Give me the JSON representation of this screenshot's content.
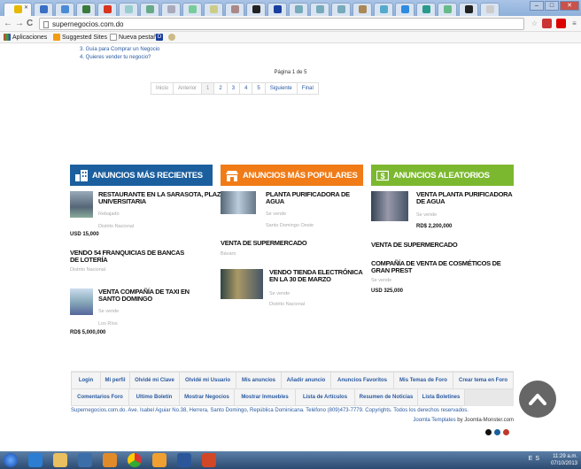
{
  "browser": {
    "url": "supernegocios.com.do",
    "bookmarks": [
      "Aplicaciones",
      "Suggested Sites",
      "Nueva pestaña"
    ]
  },
  "content": {
    "list": [
      "3.  Guía para Comprar un Negocio",
      "4.  Quieres vender tu negocio?"
    ],
    "page_info": "Página 1 de 5",
    "pager": [
      "Inicio",
      "Anterior",
      "1",
      "2",
      "3",
      "4",
      "5",
      "Siguiente",
      "Final"
    ],
    "columns": [
      {
        "title": "ANUNCIOS MÁS RECIENTES",
        "color": "#1b5f9e"
      },
      {
        "title": "ANUNCIOS MÁS POPULARES",
        "color": "#f07b17"
      },
      {
        "title": "ANUNCIOS ALEATORIOS",
        "color": "#7cb82f"
      }
    ],
    "recent": [
      {
        "title": "RESTAURANTE EN LA SARASOTA, PLAZA UNIVERSITARIA",
        "cat": "Rebajado",
        "loc": "Distrito Nacional",
        "price": "USD 15,000"
      },
      {
        "title": "VENDO 54 FRANQUICIAS DE BANCAS DE LOTERÍA",
        "loc": "Distrito Nacional"
      },
      {
        "title": "VENTA COMPAÑÍA DE TAXI EN SANTO DOMINGO",
        "cat": "Se vende",
        "loc": "Los Ríos",
        "price": "RD$ 5,000,000"
      }
    ],
    "popular": [
      {
        "title": "PLANTA PURIFICADORA DE AGUA",
        "cat": "Se vende",
        "loc": "Santo Domingo Oeste"
      },
      {
        "title": "VENTA DE SUPERMERCADO",
        "loc": "Bávaro"
      },
      {
        "title": "VENDO TIENDA ELECTRÓNICA EN LA 30 DE MARZO",
        "cat": "Se vende",
        "loc": "Distrito Nacional"
      }
    ],
    "random": [
      {
        "title": "VENTA PLANTA PURIFICADORA DE AGUA",
        "cat": "Se vende",
        "price": "RD$ 2,200,000"
      },
      {
        "title": "VENTA DE SUPERMERCADO"
      },
      {
        "title": "COMPAÑÍA DE VENTA DE COSMÉTICOS DE GRAN PREST",
        "cat": "Se vende",
        "price": "USD 325,000"
      }
    ]
  },
  "footer": {
    "nav_row1": [
      "Login",
      "Mi perfil",
      "Olvidé mi Clave",
      "Olvidé mi Usuario",
      "Mis anuncios",
      "Añadir anuncio",
      "Anuncios Favoritos",
      "Mis Temas de Foro",
      "Crear tema en Foro"
    ],
    "nav_row2": [
      "Comentarios Foro",
      "Ultimo Boletín",
      "Mostrar Negocios",
      "Mostrar Inmuebles",
      "Lista de Artículos",
      "Resumen de Noticias",
      "Lista Boletines"
    ],
    "copyright": "Supernegocios.com.do. Ave. Isabel Aguiar No.38, Herrera, Santo Domingo, República Dominicana. Teléfono (809)473-7779. Copyrights. Todos los derechos reservados.",
    "credit_link": "Joomla Templates",
    "credit_text": " by Joomla-Monster.com",
    "dot_colors": [
      "#111111",
      "#1b5f9e",
      "#c0392b"
    ]
  },
  "taskbar": {
    "time": "11:29 a.m.",
    "date": "07/10/2013",
    "tray": "ES"
  }
}
